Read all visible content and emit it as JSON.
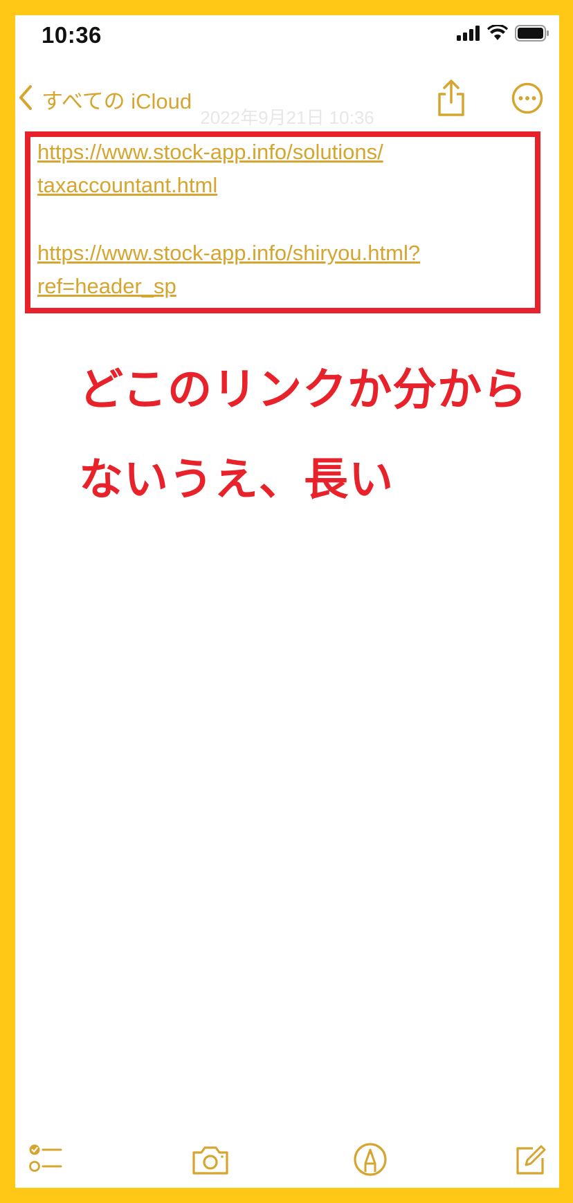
{
  "status_bar": {
    "time": "10:36",
    "icons": [
      "signal-icon",
      "wifi-icon",
      "battery-icon"
    ]
  },
  "nav": {
    "back_label": "すべての iCloud",
    "timestamp": "2022年9月21日 10:36"
  },
  "note": {
    "links": [
      {
        "line1": "https://www.stock-app.info/solutions/",
        "line2": "taxaccountant.html"
      },
      {
        "line1": "https://www.stock-app.info/shiryou.html?",
        "line2": "ref=header_sp"
      }
    ]
  },
  "annotation": {
    "line1": "どこのリンクか分から",
    "line2": "ないうえ、長い"
  },
  "toolbar": {
    "icons": [
      "checklist-icon",
      "camera-icon",
      "markup-icon",
      "compose-icon"
    ]
  },
  "colors": {
    "frame": "#FFC816",
    "accent": "#D6A530",
    "annotation": "#E8222A"
  }
}
